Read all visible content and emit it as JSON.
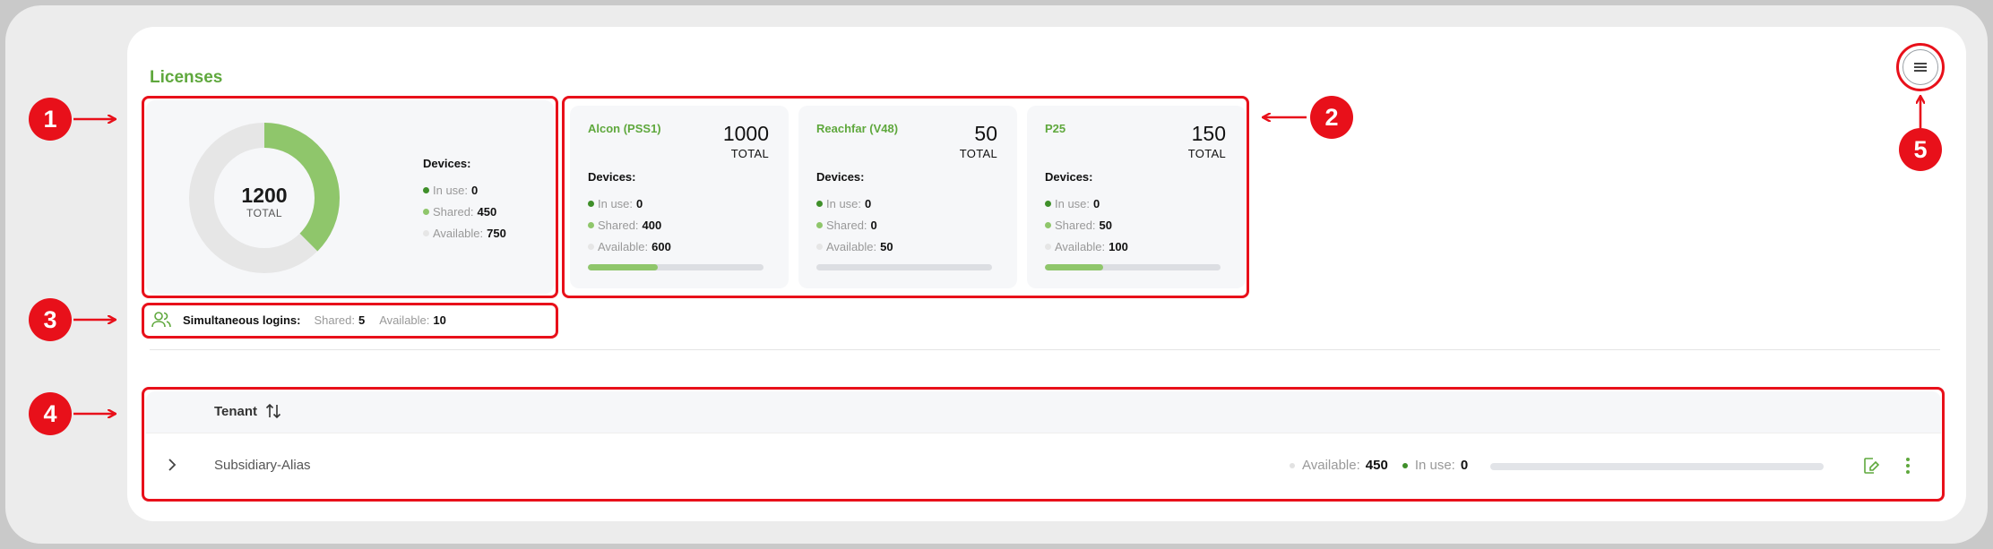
{
  "section_title": "Licenses",
  "donut": {
    "total": "1200",
    "total_label": "TOTAL",
    "devices_title": "Devices:",
    "in_use_label": "In use:",
    "in_use": "0",
    "shared_label": "Shared:",
    "shared": "450",
    "available_label": "Available:",
    "available": "750",
    "shared_fraction": 0.375
  },
  "licenses": [
    {
      "name": "Alcon (PSS1)",
      "total": "1000",
      "total_label": "TOTAL",
      "devices_title": "Devices:",
      "in_use_label": "In use:",
      "in_use": "0",
      "shared_label": "Shared:",
      "shared": "400",
      "available_label": "Available:",
      "available": "600",
      "progress": 0.4
    },
    {
      "name": "Reachfar (V48)",
      "total": "50",
      "total_label": "TOTAL",
      "devices_title": "Devices:",
      "in_use_label": "In use:",
      "in_use": "0",
      "shared_label": "Shared:",
      "shared": "0",
      "available_label": "Available:",
      "available": "50",
      "progress": 0
    },
    {
      "name": "P25",
      "total": "150",
      "total_label": "TOTAL",
      "devices_title": "Devices:",
      "in_use_label": "In use:",
      "in_use": "0",
      "shared_label": "Shared:",
      "shared": "50",
      "available_label": "Available:",
      "available": "100",
      "progress": 0.333
    }
  ],
  "logins": {
    "label": "Simultaneous logins:",
    "shared_label": "Shared:",
    "shared": "5",
    "available_label": "Available:",
    "available": "10"
  },
  "table": {
    "column_tenant": "Tenant",
    "rows": [
      {
        "tenant": "Subsidiary-Alias",
        "available_label": "Available:",
        "available": "450",
        "in_use_label": "In use:",
        "in_use": "0",
        "progress": 0
      }
    ]
  },
  "annotations": [
    "1",
    "2",
    "3",
    "4",
    "5"
  ],
  "colors": {
    "accent_green": "#5fa83d",
    "shared_green": "#8fc66b",
    "available_gray": "#e6e6e6",
    "annotation_red": "#e8101a"
  },
  "icons": [
    "menu-icon",
    "users-icon",
    "sort-icon",
    "chevron-right-icon",
    "edit-license-icon",
    "more-vertical-icon"
  ]
}
